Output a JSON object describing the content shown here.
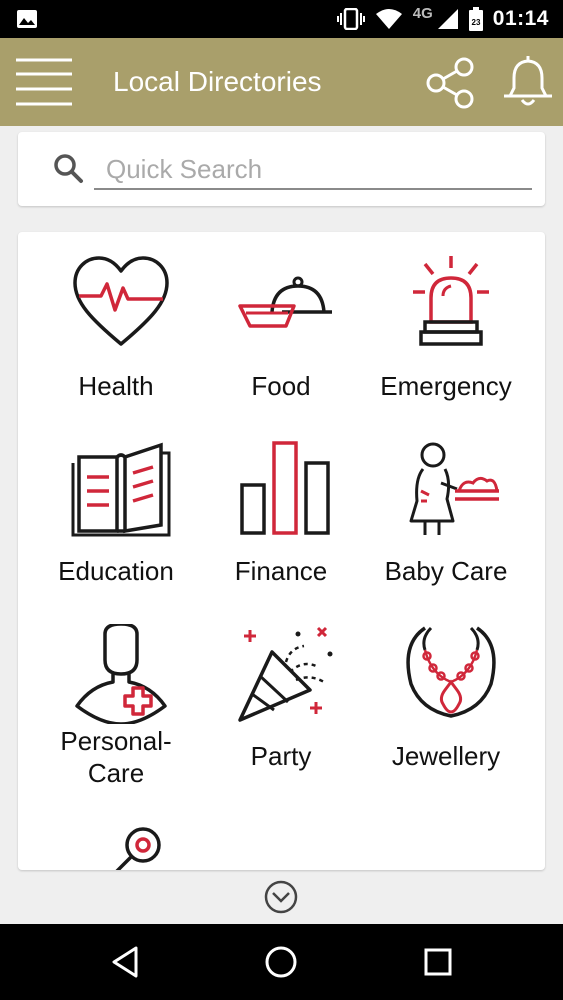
{
  "status_bar": {
    "time": "01:14",
    "network": "4G",
    "icons": [
      "image-icon",
      "vibrate-icon",
      "wifi-icon",
      "signal-icon",
      "battery-icon"
    ]
  },
  "app_bar": {
    "title": "Local Directories",
    "icons": [
      "menu-icon",
      "share-icon",
      "bell-icon"
    ]
  },
  "search": {
    "placeholder": "Quick Search",
    "value": ""
  },
  "categories": [
    {
      "label": "Health",
      "icon": "heart-pulse-icon"
    },
    {
      "label": "Food",
      "icon": "food-cloche-icon"
    },
    {
      "label": "Emergency",
      "icon": "siren-icon"
    },
    {
      "label": "Education",
      "icon": "book-icon"
    },
    {
      "label": "Finance",
      "icon": "bar-chart-icon"
    },
    {
      "label": "Baby Care",
      "icon": "baby-care-icon"
    },
    {
      "label": "Personal-\nCare",
      "icon": "personal-care-icon"
    },
    {
      "label": "Party",
      "icon": "party-popper-icon"
    },
    {
      "label": "Jewellery",
      "icon": "necklace-icon"
    },
    {
      "label": "",
      "icon": "key-icon"
    }
  ],
  "colors": {
    "app_bar": "#a99f6b",
    "accent_red": "#d0273a",
    "icon_dark": "#1a1a1a",
    "background": "#efefef",
    "status_bar": "#000000"
  }
}
